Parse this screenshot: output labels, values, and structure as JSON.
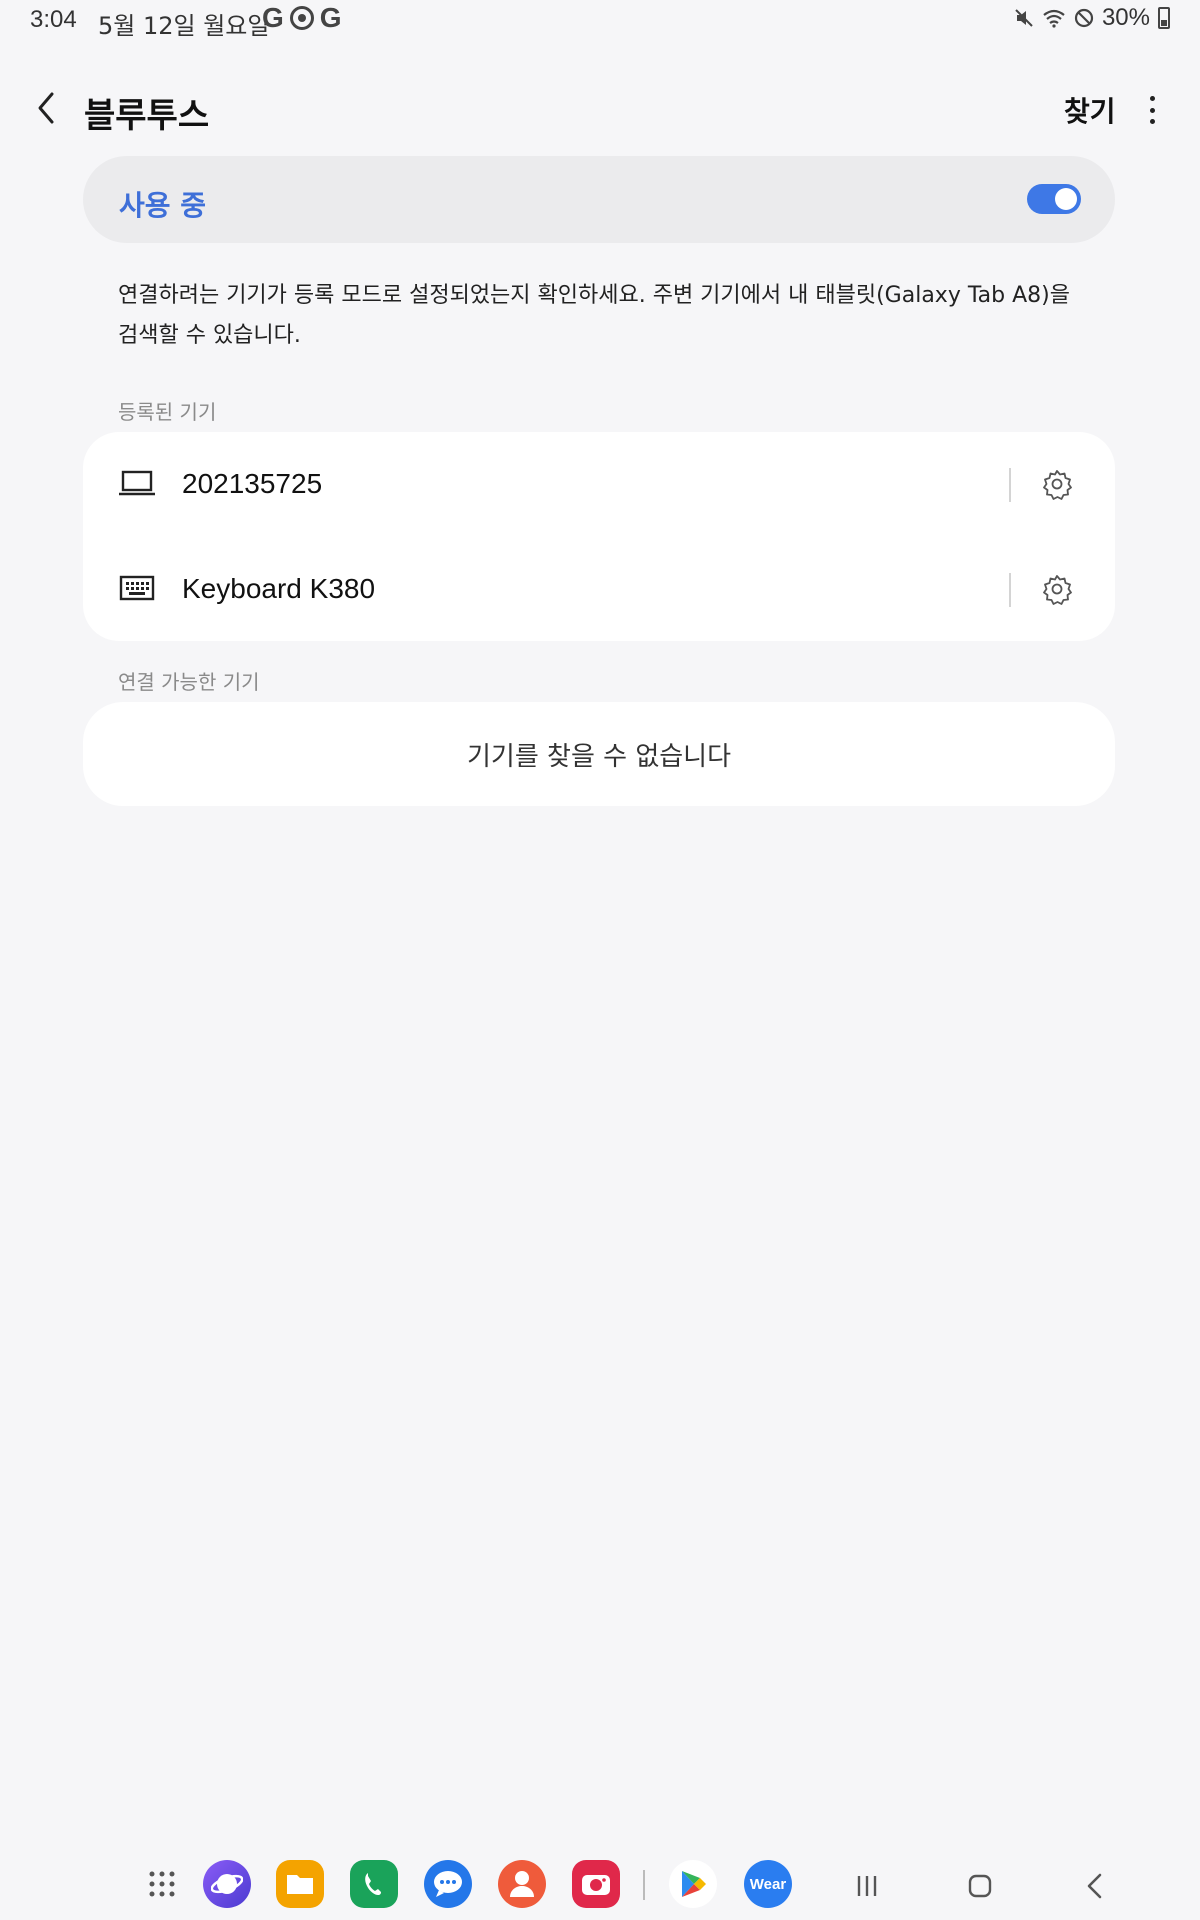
{
  "status_bar": {
    "time": "3:04",
    "date": "5월 12일 월요일",
    "battery": "30%",
    "icons": [
      "google-icon",
      "gemini-icon",
      "google-icon",
      "mute-icon",
      "wifi-icon",
      "block-icon",
      "battery-icon"
    ]
  },
  "header": {
    "title": "블루투스",
    "search_label": "찾기"
  },
  "toggle_card": {
    "label": "사용 중",
    "enabled": true,
    "accent_color": "#3e78e6"
  },
  "description": "연결하려는 기기가 등록 모드로 설정되었는지 확인하세요. 주변 기기에서 내 태블릿(Galaxy Tab A8)을 검색할 수 있습니다.",
  "registered": {
    "section_label": "등록된 기기",
    "devices": [
      {
        "name": "202135725",
        "icon": "laptop-icon"
      },
      {
        "name": "Keyboard K380",
        "icon": "keyboard-icon"
      }
    ]
  },
  "available": {
    "section_label": "연결 가능한 기기",
    "empty_message": "기기를 찾을 수 없습니다"
  },
  "dock": {
    "apps": [
      "apps-grid-icon",
      "internet-icon",
      "my-files-icon",
      "phone-icon",
      "messages-icon",
      "contacts-icon",
      "camera-icon",
      "play-store-icon",
      "wear-icon"
    ],
    "wear_label": "Wear"
  }
}
